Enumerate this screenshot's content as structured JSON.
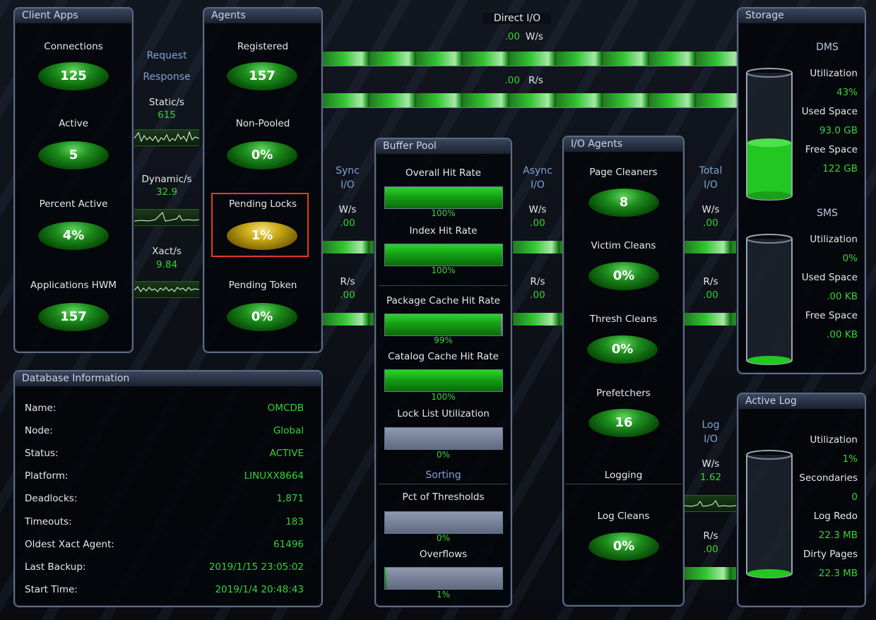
{
  "client_apps": {
    "title": "Client Apps",
    "connections_label": "Connections",
    "connections_value": "125",
    "active_label": "Active",
    "active_value": "5",
    "percent_active_label": "Percent Active",
    "percent_active_value": "4%",
    "hwm_label": "Applications HWM",
    "hwm_value": "157"
  },
  "request_response": {
    "request_label": "Request",
    "response_label": "Response",
    "static_label": "Static/s",
    "static_value": "615",
    "dynamic_label": "Dynamic/s",
    "dynamic_value": "32.9",
    "xact_label": "Xact/s",
    "xact_value": "9.84"
  },
  "agents": {
    "title": "Agents",
    "registered_label": "Registered",
    "registered_value": "157",
    "nonpooled_label": "Non-Pooled",
    "nonpooled_value": "0%",
    "pending_locks_label": "Pending Locks",
    "pending_locks_value": "1%",
    "pending_token_label": "Pending Token",
    "pending_token_value": "0%"
  },
  "direct_io": {
    "title": "Direct I/O",
    "write_value": ".00",
    "write_unit": "W/s",
    "read_value": ".00",
    "read_unit": "R/s"
  },
  "sync_io": {
    "label1": "Sync",
    "label2": "I/O",
    "write_label": "W/s",
    "write_value": ".00",
    "read_label": "R/s",
    "read_value": ".00"
  },
  "buffer_pool": {
    "title": "Buffer Pool",
    "overall_label": "Overall Hit Rate",
    "overall_value": "100%",
    "overall_fraction": 1.0,
    "index_label": "Index Hit Rate",
    "index_value": "100%",
    "index_fraction": 1.0,
    "package_label": "Package Cache Hit Rate",
    "package_value": "99%",
    "package_fraction": 0.99,
    "catalog_label": "Catalog Cache Hit Rate",
    "catalog_value": "100%",
    "catalog_fraction": 1.0,
    "locklist_label": "Lock List Utilization",
    "locklist_value": "0%",
    "locklist_fraction": 0.0,
    "sorting_label": "Sorting",
    "pct_thresholds_label": "Pct of Thresholds",
    "pct_thresholds_value": "0%",
    "pct_thresholds_fraction": 0.0,
    "overflows_label": "Overflows",
    "overflows_value": "1%",
    "overflows_fraction": 0.01
  },
  "async_io": {
    "label1": "Async",
    "label2": "I/O",
    "write_label": "W/s",
    "write_value": ".00",
    "read_label": "R/s",
    "read_value": ".00"
  },
  "io_agents": {
    "title": "I/O Agents",
    "page_cleaners_label": "Page Cleaners",
    "page_cleaners_value": "8",
    "victim_label": "Victim Cleans",
    "victim_value": "0%",
    "thresh_label": "Thresh Cleans",
    "thresh_value": "0%",
    "prefetchers_label": "Prefetchers",
    "prefetchers_value": "16",
    "logging_label": "Logging",
    "log_cleans_label": "Log Cleans",
    "log_cleans_value": "0%"
  },
  "total_io": {
    "label1": "Total",
    "label2": "I/O",
    "write_label": "W/s",
    "write_value": ".00",
    "read_label": "R/s",
    "read_value": ".00"
  },
  "log_io": {
    "label1": "Log",
    "label2": "I/O",
    "write_label": "W/s",
    "write_value": "1.62",
    "read_label": "R/s",
    "read_value": ".00"
  },
  "storage": {
    "title": "Storage",
    "dms_label": "DMS",
    "dms_util_label": "Utilization",
    "dms_util_value": "43%",
    "dms_fill": 0.43,
    "dms_used_label": "Used Space",
    "dms_used_value": "93.0 GB",
    "dms_free_label": "Free Space",
    "dms_free_value": "122 GB",
    "sms_label": "SMS",
    "sms_util_label": "Utilization",
    "sms_util_value": "0%",
    "sms_fill": 0.0,
    "sms_used_label": "Used Space",
    "sms_used_value": ".00 KB",
    "sms_free_label": "Free Space",
    "sms_free_value": ".00 KB"
  },
  "active_log": {
    "title": "Active Log",
    "util_label": "Utilization",
    "util_value": "1%",
    "fill": 0.01,
    "secondaries_label": "Secondaries",
    "secondaries_value": "0",
    "redo_label": "Log Redo",
    "redo_value": "22.3 MB",
    "dirty_label": "Dirty Pages",
    "dirty_value": "22.3 MB"
  },
  "db_info": {
    "title": "Database Information",
    "rows": [
      {
        "label": "Name:",
        "value": "OMCDB"
      },
      {
        "label": "Node:",
        "value": "Global"
      },
      {
        "label": "Status:",
        "value": "ACTIVE"
      },
      {
        "label": "Platform:",
        "value": "LINUXX8664"
      },
      {
        "label": "Deadlocks:",
        "value": "1,871"
      },
      {
        "label": "Timeouts:",
        "value": "183"
      },
      {
        "label": "Oldest Xact Agent:",
        "value": "61496"
      },
      {
        "label": "Last Backup:",
        "value": "2019/1/15 23:05:02"
      },
      {
        "label": "Start Time:",
        "value": "2019/1/4 20:48:43"
      }
    ]
  },
  "colors": {
    "green": "#36d336",
    "blue_label": "#7ea2d6",
    "highlight_box": "#e23a2e"
  }
}
